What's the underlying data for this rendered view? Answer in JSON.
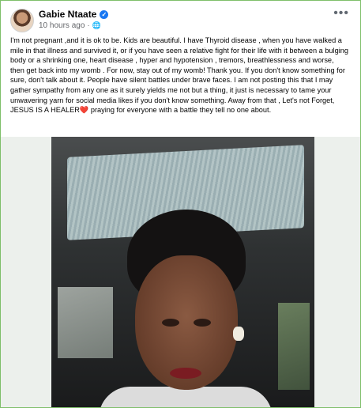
{
  "post": {
    "author": "Gabie Ntaate",
    "verified": true,
    "time": "10 hours ago",
    "separator": "·",
    "audience_icon": "globe-icon",
    "more_label": "•••",
    "text": "I'm not pregnant ,and it is ok to be. Kids are beautiful. I have Thyroid disease , when you have walked a mile in that illness and survived it, or if you have seen a relative fight for their life with it between a bulging body or a shrinking one, heart disease , hyper and hypotension , tremors, breathlessness and worse, then get back into my womb . For now, stay out of my womb! Thank you. If you don't know something for sure, don't talk about it. People have silent battles under brave faces.  I am not posting this that I may gather sympathy from any one as it surely yields me not but a thing, it just is necessary to tame your unwavering yarn for social media likes if you don't know something. Away from that , Let's not Forget, JESUS IS A HEALER",
    "text_end": " praying for everyone with a battle they tell no one about.",
    "heart_emoji": "❤️"
  },
  "colors": {
    "verified_badge": "#1877f2",
    "frame_border": "#7fbf6a",
    "media_background": "#ecf0ec"
  }
}
